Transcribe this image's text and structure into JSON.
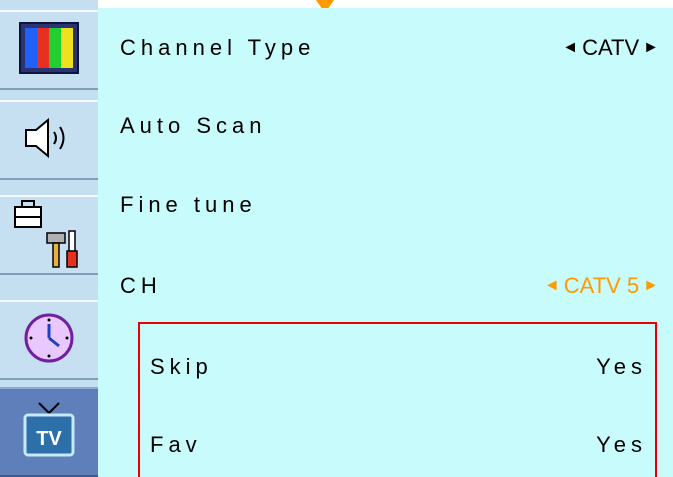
{
  "sidebar": {
    "items": [
      {
        "icon": "color-bars-icon",
        "active": false
      },
      {
        "icon": "speaker-icon",
        "active": false
      },
      {
        "icon": "toolbox-icon",
        "active": false
      },
      {
        "icon": "clock-icon",
        "active": false
      },
      {
        "icon": "tv-icon",
        "active": true,
        "icon_text": "TV"
      }
    ]
  },
  "menu": {
    "rows": [
      {
        "label": "Channel Type",
        "value": "CATV",
        "left_arrow": "◄",
        "right_arrow": "►"
      },
      {
        "label": "Auto Scan"
      },
      {
        "label": "Fine tune"
      },
      {
        "label": "CH",
        "value": "CATV 5",
        "left_arrow": "◄",
        "right_arrow": "►"
      }
    ],
    "sub": [
      {
        "label": "Skip",
        "value": "Yes"
      },
      {
        "label": "Fav",
        "value": "Yes"
      }
    ]
  },
  "colors": {
    "background": "#c8fbfb",
    "sidebar": "#c4dff0",
    "highlight_orange": "#ff9a00",
    "active_tab": "#5f7fba",
    "panel_border": "#e60000"
  }
}
